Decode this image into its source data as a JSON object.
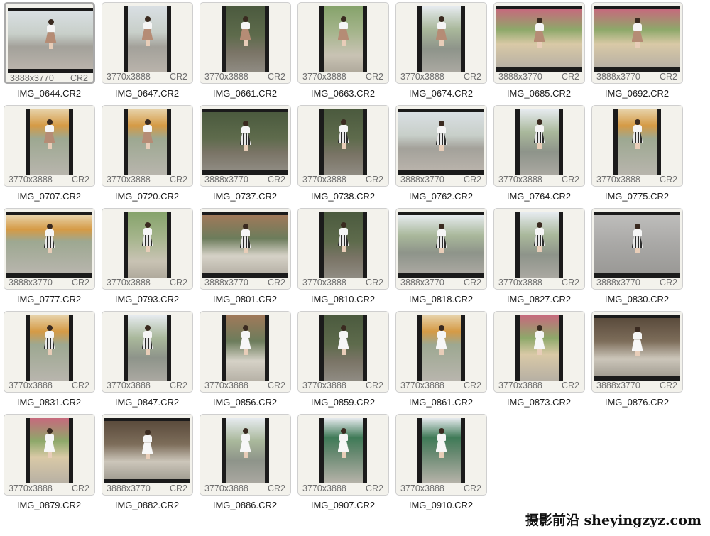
{
  "view": {
    "selected_index": 0
  },
  "files": [
    {
      "name": "IMG_0644.CR2",
      "dims": "3888x3770",
      "ext": "CR2",
      "orientation": "landscape",
      "scene": "street-flowers",
      "outfit": "brown"
    },
    {
      "name": "IMG_0647.CR2",
      "dims": "3770x3888",
      "ext": "CR2",
      "orientation": "portrait",
      "scene": "street-flowers",
      "outfit": "brown"
    },
    {
      "name": "IMG_0661.CR2",
      "dims": "3770x3888",
      "ext": "CR2",
      "orientation": "portrait",
      "scene": "garden-dark",
      "outfit": "brown"
    },
    {
      "name": "IMG_0663.CR2",
      "dims": "3770x3888",
      "ext": "CR2",
      "orientation": "portrait",
      "scene": "greenery",
      "outfit": "brown"
    },
    {
      "name": "IMG_0674.CR2",
      "dims": "3770x3888",
      "ext": "CR2",
      "orientation": "portrait",
      "scene": "street-trees",
      "outfit": "brown"
    },
    {
      "name": "IMG_0685.CR2",
      "dims": "3888x3770",
      "ext": "CR2",
      "orientation": "landscape",
      "scene": "flower-shop",
      "outfit": "brown"
    },
    {
      "name": "IMG_0692.CR2",
      "dims": "3888x3770",
      "ext": "CR2",
      "orientation": "landscape",
      "scene": "flower-shop",
      "outfit": "brown"
    },
    {
      "name": "IMG_0707.CR2",
      "dims": "3770x3888",
      "ext": "CR2",
      "orientation": "portrait",
      "scene": "umbrella-street",
      "outfit": "brown"
    },
    {
      "name": "IMG_0720.CR2",
      "dims": "3770x3888",
      "ext": "CR2",
      "orientation": "portrait",
      "scene": "umbrella-street",
      "outfit": "brown"
    },
    {
      "name": "IMG_0737.CR2",
      "dims": "3888x3770",
      "ext": "CR2",
      "orientation": "landscape",
      "scene": "garden-dark",
      "outfit": "plaid"
    },
    {
      "name": "IMG_0738.CR2",
      "dims": "3770x3888",
      "ext": "CR2",
      "orientation": "portrait",
      "scene": "garden-dark",
      "outfit": "plaid"
    },
    {
      "name": "IMG_0762.CR2",
      "dims": "3888x3770",
      "ext": "CR2",
      "orientation": "landscape",
      "scene": "street-flowers",
      "outfit": "plaid"
    },
    {
      "name": "IMG_0764.CR2",
      "dims": "3770x3888",
      "ext": "CR2",
      "orientation": "portrait",
      "scene": "street-trees",
      "outfit": "plaid"
    },
    {
      "name": "IMG_0775.CR2",
      "dims": "3770x3888",
      "ext": "CR2",
      "orientation": "portrait",
      "scene": "umbrella-street",
      "outfit": "plaid"
    },
    {
      "name": "IMG_0777.CR2",
      "dims": "3888x3770",
      "ext": "CR2",
      "orientation": "landscape",
      "scene": "umbrella-street",
      "outfit": "plaid"
    },
    {
      "name": "IMG_0793.CR2",
      "dims": "3770x3888",
      "ext": "CR2",
      "orientation": "portrait",
      "scene": "greenery",
      "outfit": "plaid"
    },
    {
      "name": "IMG_0801.CR2",
      "dims": "3888x3770",
      "ext": "CR2",
      "orientation": "landscape",
      "scene": "cafe",
      "outfit": "plaid"
    },
    {
      "name": "IMG_0810.CR2",
      "dims": "3770x3888",
      "ext": "CR2",
      "orientation": "portrait",
      "scene": "garden-dark",
      "outfit": "plaid"
    },
    {
      "name": "IMG_0818.CR2",
      "dims": "3888x3770",
      "ext": "CR2",
      "orientation": "landscape",
      "scene": "street-trees",
      "outfit": "plaid"
    },
    {
      "name": "IMG_0827.CR2",
      "dims": "3770x3888",
      "ext": "CR2",
      "orientation": "portrait",
      "scene": "street-trees",
      "outfit": "plaid"
    },
    {
      "name": "IMG_0830.CR2",
      "dims": "3888x3770",
      "ext": "CR2",
      "orientation": "landscape",
      "scene": "pavement",
      "outfit": "plaid"
    },
    {
      "name": "IMG_0831.CR2",
      "dims": "3770x3888",
      "ext": "CR2",
      "orientation": "portrait",
      "scene": "umbrella-street",
      "outfit": "plaid"
    },
    {
      "name": "IMG_0847.CR2",
      "dims": "3770x3888",
      "ext": "CR2",
      "orientation": "portrait",
      "scene": "street-trees",
      "outfit": "plaid"
    },
    {
      "name": "IMG_0856.CR2",
      "dims": "3770x3888",
      "ext": "CR2",
      "orientation": "portrait",
      "scene": "cafe",
      "outfit": "white"
    },
    {
      "name": "IMG_0859.CR2",
      "dims": "3770x3888",
      "ext": "CR2",
      "orientation": "portrait",
      "scene": "garden-dark",
      "outfit": "white"
    },
    {
      "name": "IMG_0861.CR2",
      "dims": "3770x3888",
      "ext": "CR2",
      "orientation": "portrait",
      "scene": "umbrella-street",
      "outfit": "white"
    },
    {
      "name": "IMG_0873.CR2",
      "dims": "3770x3888",
      "ext": "CR2",
      "orientation": "portrait",
      "scene": "flower-shop",
      "outfit": "white"
    },
    {
      "name": "IMG_0876.CR2",
      "dims": "3888x3770",
      "ext": "CR2",
      "orientation": "landscape",
      "scene": "shop-interior",
      "outfit": "white"
    },
    {
      "name": "IMG_0879.CR2",
      "dims": "3770x3888",
      "ext": "CR2",
      "orientation": "portrait",
      "scene": "flower-shop",
      "outfit": "white"
    },
    {
      "name": "IMG_0882.CR2",
      "dims": "3888x3770",
      "ext": "CR2",
      "orientation": "landscape",
      "scene": "shop-interior",
      "outfit": "white"
    },
    {
      "name": "IMG_0886.CR2",
      "dims": "3770x3888",
      "ext": "CR2",
      "orientation": "portrait",
      "scene": "street-trees",
      "outfit": "white"
    },
    {
      "name": "IMG_0907.CR2",
      "dims": "3770x3888",
      "ext": "CR2",
      "orientation": "portrait",
      "scene": "green-house",
      "outfit": "white"
    },
    {
      "name": "IMG_0910.CR2",
      "dims": "3770x3888",
      "ext": "CR2",
      "orientation": "portrait",
      "scene": "green-house",
      "outfit": "white"
    }
  ],
  "watermark": "摄影前沿 sheyingzyz.com"
}
